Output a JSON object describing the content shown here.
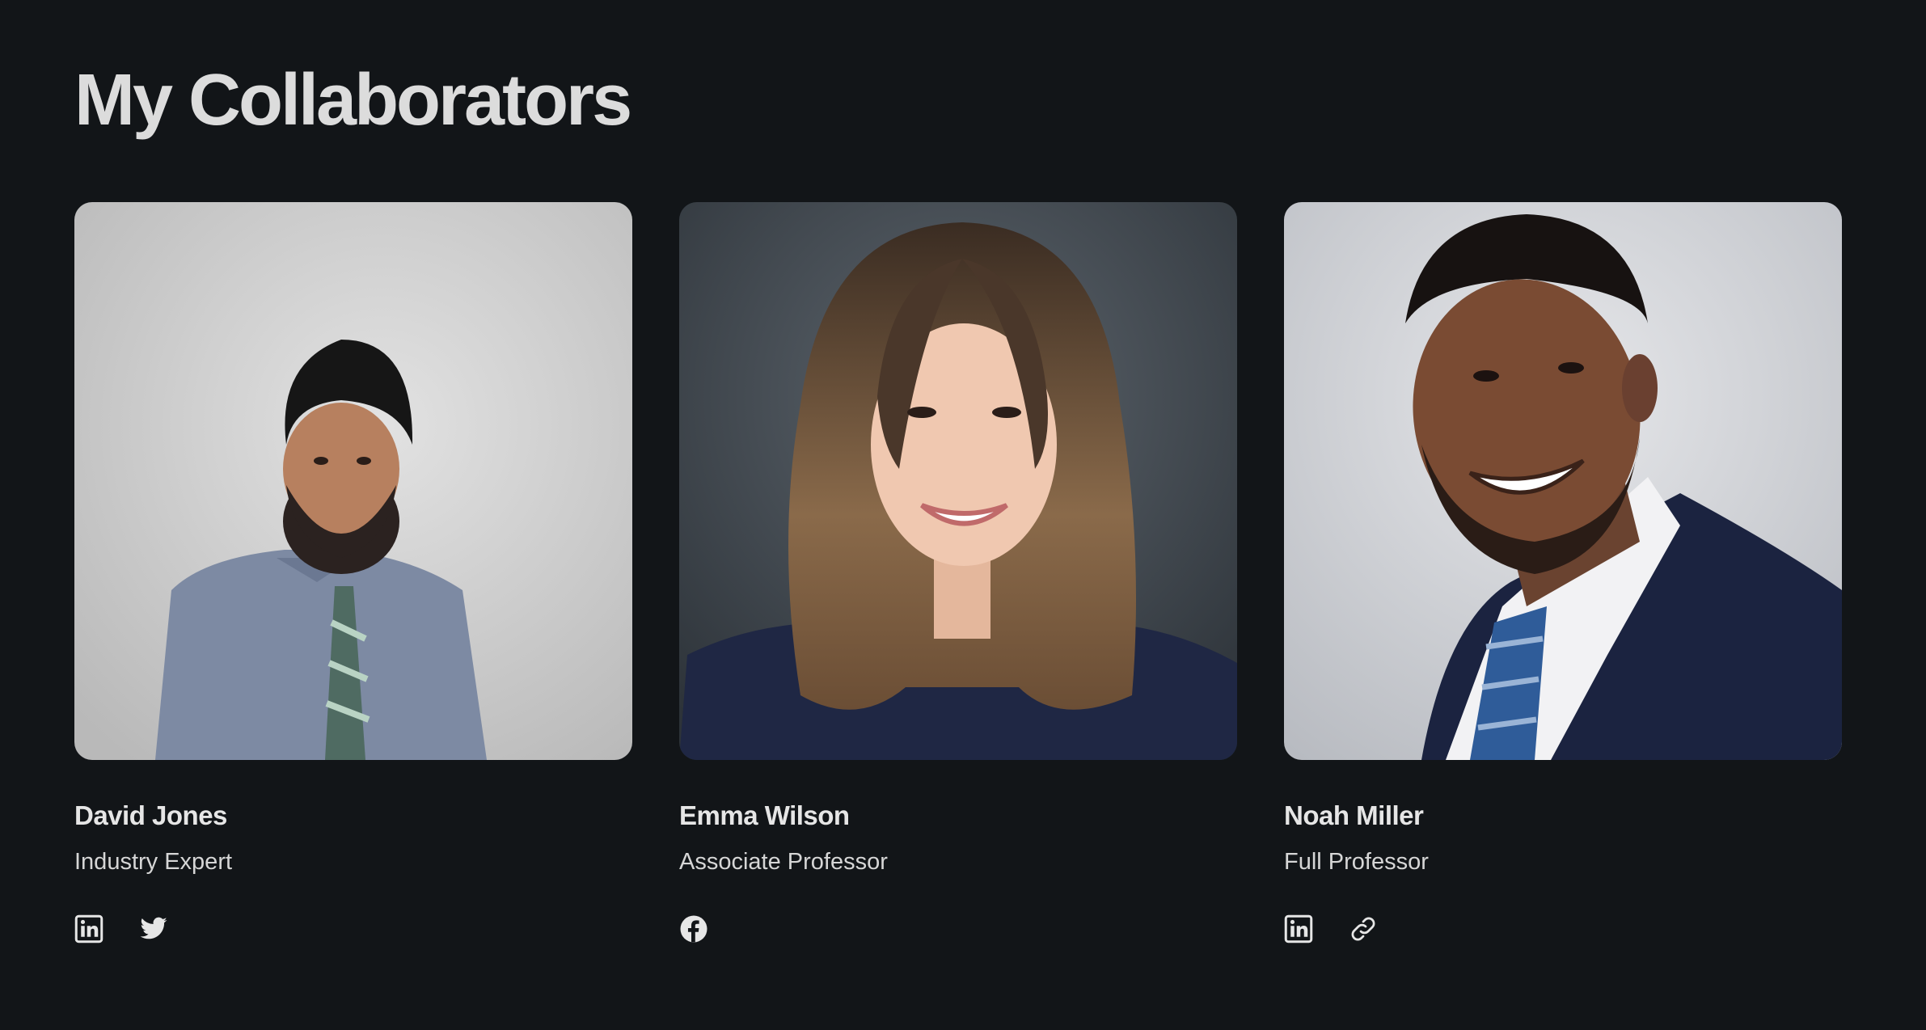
{
  "page": {
    "title": "My Collaborators"
  },
  "collaborators": [
    {
      "name": "David Jones",
      "role": "Industry Expert",
      "photo_icon": "portrait-man-turban",
      "socials": [
        "linkedin-icon",
        "twitter-icon"
      ]
    },
    {
      "name": "Emma Wilson",
      "role": "Associate Professor",
      "photo_icon": "portrait-woman",
      "socials": [
        "facebook-icon"
      ]
    },
    {
      "name": "Noah Miller",
      "role": "Full Professor",
      "photo_icon": "portrait-man-suit",
      "socials": [
        "linkedin-icon",
        "link-icon"
      ]
    }
  ],
  "colors": {
    "background": "#121518",
    "title": "#dcdcdc",
    "text": "#e6e6e6"
  }
}
